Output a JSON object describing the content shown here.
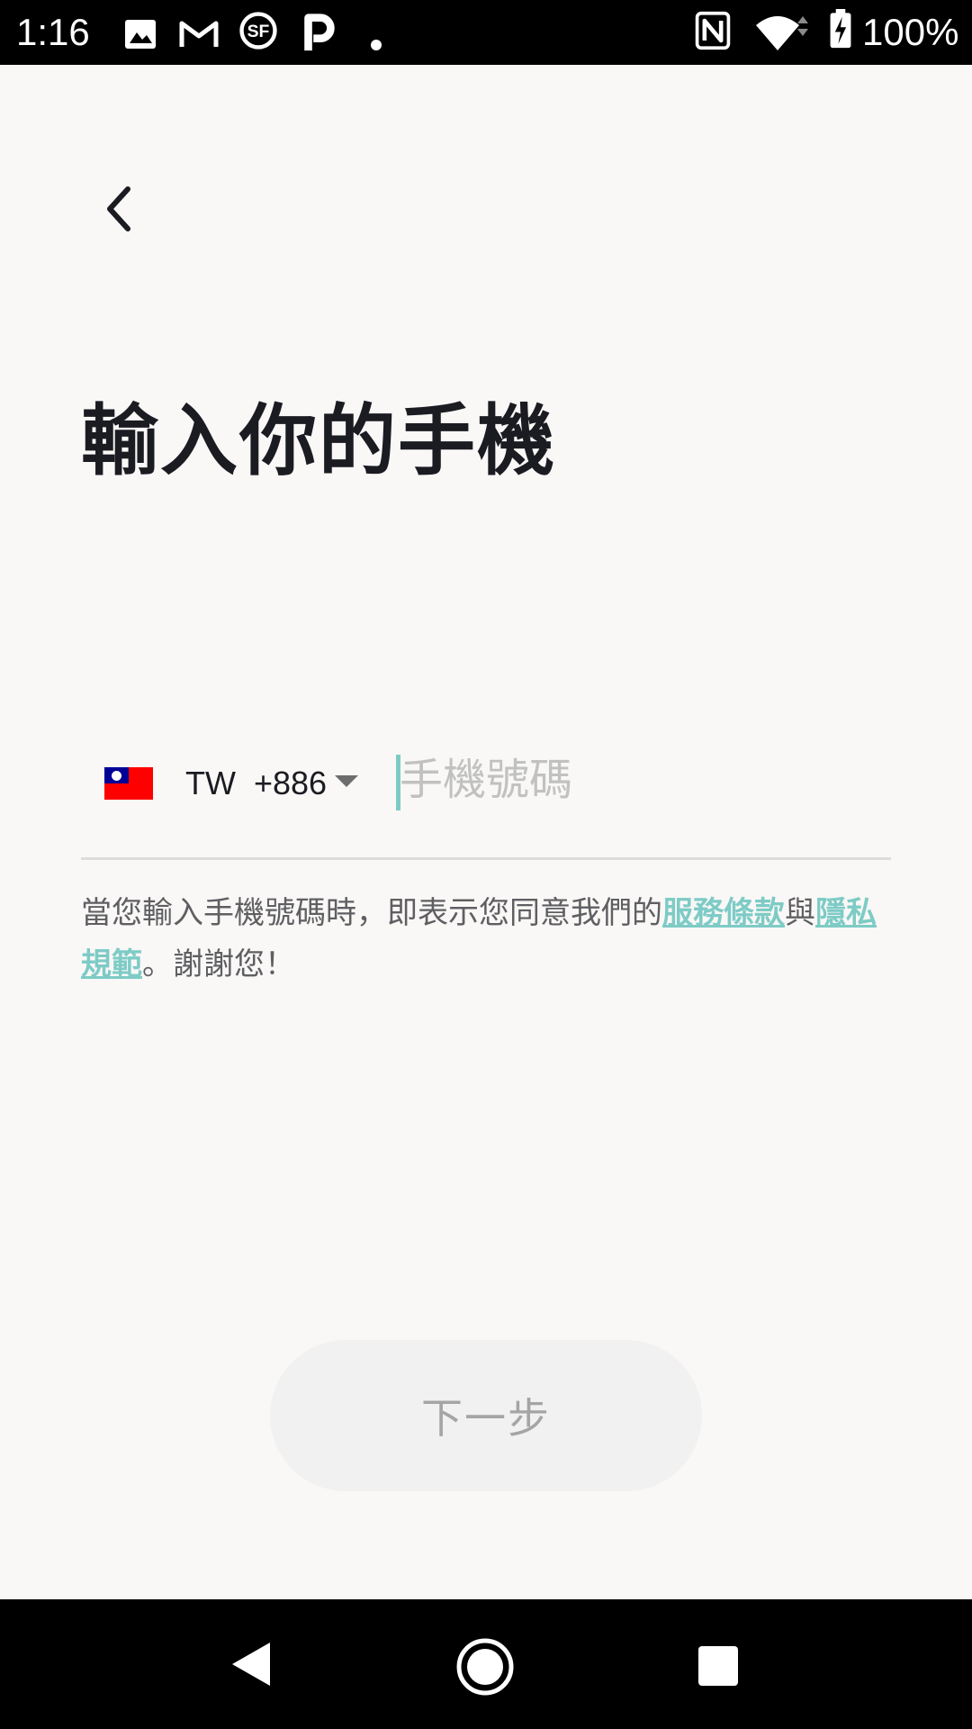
{
  "status_bar": {
    "time": "1:16",
    "battery_percent": "100%",
    "notification_icons": [
      "gallery-icon",
      "gmail-icon",
      "sf-icon",
      "p-app-icon",
      "dot-icon"
    ],
    "system_icons": [
      "nfc-icon",
      "wifi-icon",
      "battery-charging-icon"
    ]
  },
  "header": {
    "back_icon": "chevron-left-icon"
  },
  "main": {
    "title": "輸入你的手機",
    "country": {
      "flag_icon": "taiwan-flag-icon",
      "code": "TW",
      "dial_code": "+886"
    },
    "phone": {
      "placeholder": "手機號碼",
      "value": ""
    },
    "terms": {
      "prefix": "當您輸入手機號碼時，即表示您同意我們的",
      "terms_link": "服務條款",
      "conjunction": "與",
      "privacy_link": "隱私規範",
      "suffix": "。謝謝您！"
    },
    "next_button": "下一步"
  },
  "nav_bar": {
    "buttons": [
      "nav-back-icon",
      "nav-home-icon",
      "nav-recents-icon"
    ]
  },
  "colors": {
    "accent": "#7ecbc6",
    "background": "#f9f8f6",
    "title": "#1b1b22",
    "button_bg": "#f1f1f1",
    "button_text": "#a5a5a5"
  }
}
